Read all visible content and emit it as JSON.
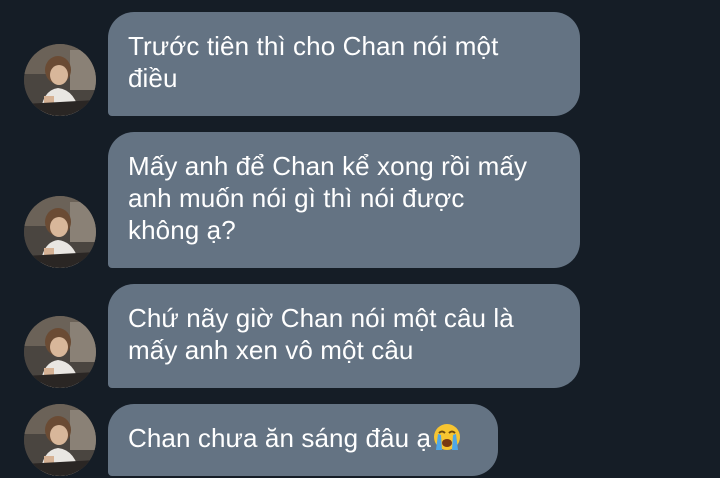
{
  "theme": {
    "background": "#151d26",
    "bubble_color": "#647383",
    "text_color": "#ffffff"
  },
  "messages": [
    {
      "text": "Trước tiên thì cho Chan nói một\nđiều"
    },
    {
      "text": "Mấy anh để Chan kể xong rồi mấy\nanh muốn nói gì thì nói được\nkhông ạ?"
    },
    {
      "text": "Chứ nãy giờ Chan nói một câu là\nmấy anh xen vô một câu"
    },
    {
      "text": "Chan chưa ăn sáng đâu ạ",
      "emoji": "loudly-crying-face-icon"
    }
  ]
}
